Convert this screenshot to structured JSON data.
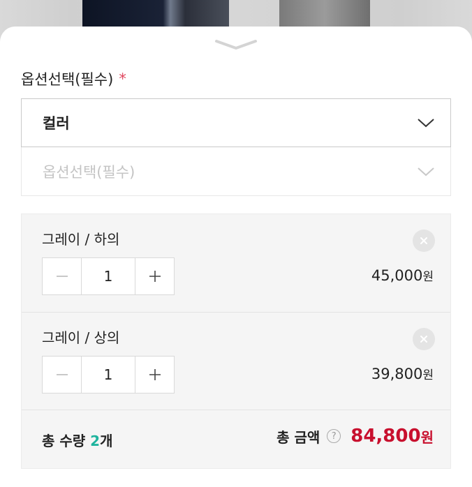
{
  "colors": {
    "accent_red": "#c8102e",
    "count_green": "#1fb49e",
    "star": "#e0475f"
  },
  "sheet": {
    "handle_icon": "chevron-down-icon"
  },
  "option_section": {
    "title": "옵션선택(필수)",
    "required_mark": "*"
  },
  "selects": {
    "color": {
      "label": "컬러",
      "icon": "chevron-down-icon"
    },
    "option": {
      "placeholder": "옵션선택(필수)",
      "icon": "chevron-down-icon"
    }
  },
  "items": [
    {
      "name": "그레이 / 하의",
      "quantity": "1",
      "price": "45,000",
      "currency": "원",
      "minus": "minus-icon",
      "plus": "plus-icon",
      "remove": "close-icon"
    },
    {
      "name": "그레이 / 상의",
      "quantity": "1",
      "price": "39,800",
      "currency": "원",
      "minus": "minus-icon",
      "plus": "plus-icon",
      "remove": "close-icon"
    }
  ],
  "summary": {
    "qty_label": "총 수량 ",
    "qty_count": "2",
    "qty_unit": "개",
    "amount_label": "총 금액",
    "help_icon_text": "?",
    "amount": "84,800",
    "currency": "원"
  }
}
